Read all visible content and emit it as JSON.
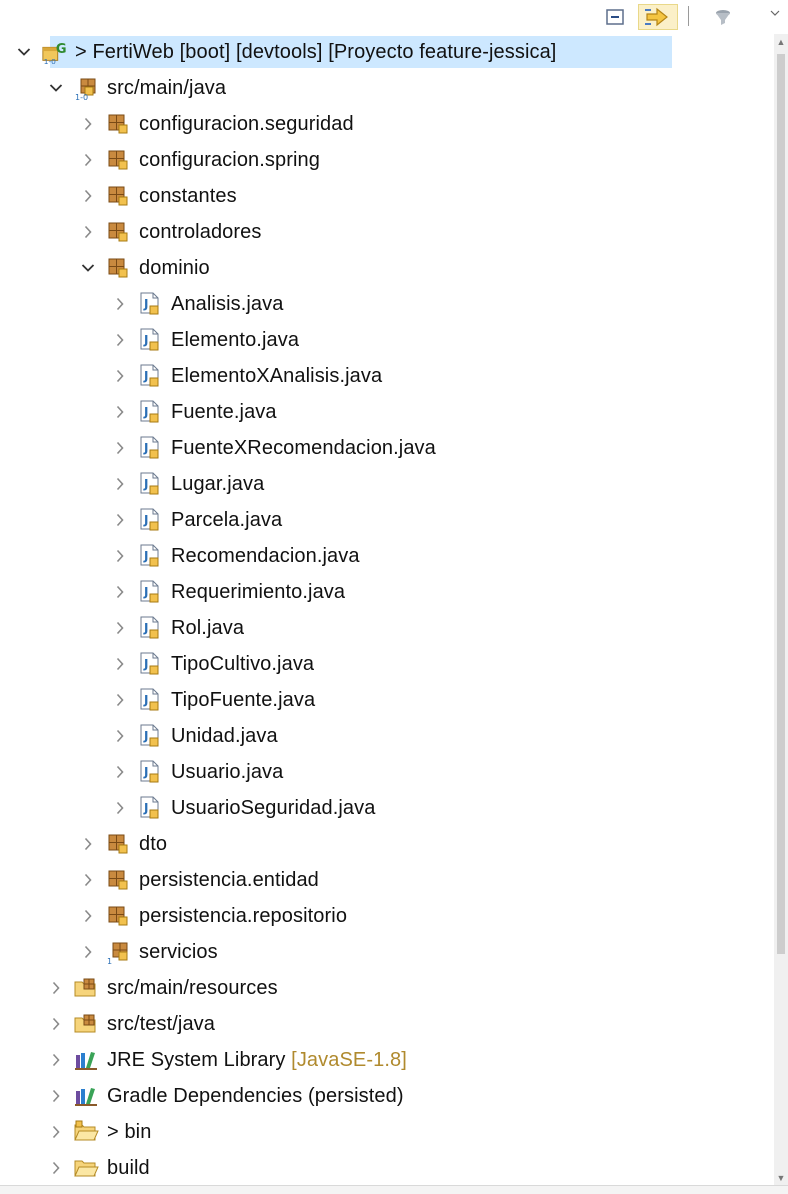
{
  "toolbar": {
    "collapse_icon": "collapse-all-icon",
    "link_icon": "link-with-editor-icon",
    "filter_icon": "filter-icon",
    "menu_icon": "view-menu-icon"
  },
  "colors": {
    "selection": "#cde8ff",
    "text": "#111111",
    "decoration": "#b08a2e",
    "package_brown": "#8a5a2b",
    "java_blue": "#2b6fb6"
  },
  "tree": [
    {
      "level": 0,
      "expanded": true,
      "icon": "gradle-project-icon",
      "prefix": "> ",
      "text": "FertiWeb [boot] [devtools] [Proyecto feature-jessica]",
      "suffix": "",
      "selected": true
    },
    {
      "level": 1,
      "expanded": true,
      "icon": "source-folder-icon",
      "prefix": "",
      "text": "src/main/java",
      "suffix": ""
    },
    {
      "level": 2,
      "expanded": false,
      "icon": "package-icon",
      "prefix": "",
      "text": "configuracion.seguridad",
      "suffix": ""
    },
    {
      "level": 2,
      "expanded": false,
      "icon": "package-icon",
      "prefix": "",
      "text": "configuracion.spring",
      "suffix": ""
    },
    {
      "level": 2,
      "expanded": false,
      "icon": "package-icon",
      "prefix": "",
      "text": "constantes",
      "suffix": ""
    },
    {
      "level": 2,
      "expanded": false,
      "icon": "package-icon",
      "prefix": "",
      "text": "controladores",
      "suffix": ""
    },
    {
      "level": 2,
      "expanded": true,
      "icon": "package-icon",
      "prefix": "",
      "text": "dominio",
      "suffix": ""
    },
    {
      "level": 3,
      "expanded": false,
      "icon": "java-file-icon",
      "prefix": "",
      "text": "Analisis.java",
      "suffix": ""
    },
    {
      "level": 3,
      "expanded": false,
      "icon": "java-file-icon",
      "prefix": "",
      "text": "Elemento.java",
      "suffix": ""
    },
    {
      "level": 3,
      "expanded": false,
      "icon": "java-file-icon",
      "prefix": "",
      "text": "ElementoXAnalisis.java",
      "suffix": ""
    },
    {
      "level": 3,
      "expanded": false,
      "icon": "java-file-icon",
      "prefix": "",
      "text": "Fuente.java",
      "suffix": ""
    },
    {
      "level": 3,
      "expanded": false,
      "icon": "java-file-icon",
      "prefix": "",
      "text": "FuenteXRecomendacion.java",
      "suffix": ""
    },
    {
      "level": 3,
      "expanded": false,
      "icon": "java-file-icon",
      "prefix": "",
      "text": "Lugar.java",
      "suffix": ""
    },
    {
      "level": 3,
      "expanded": false,
      "icon": "java-file-icon",
      "prefix": "",
      "text": "Parcela.java",
      "suffix": ""
    },
    {
      "level": 3,
      "expanded": false,
      "icon": "java-file-icon",
      "prefix": "",
      "text": "Recomendacion.java",
      "suffix": ""
    },
    {
      "level": 3,
      "expanded": false,
      "icon": "java-file-icon",
      "prefix": "",
      "text": "Requerimiento.java",
      "suffix": ""
    },
    {
      "level": 3,
      "expanded": false,
      "icon": "java-file-icon",
      "prefix": "",
      "text": "Rol.java",
      "suffix": ""
    },
    {
      "level": 3,
      "expanded": false,
      "icon": "java-file-icon",
      "prefix": "",
      "text": "TipoCultivo.java",
      "suffix": ""
    },
    {
      "level": 3,
      "expanded": false,
      "icon": "java-file-icon",
      "prefix": "",
      "text": "TipoFuente.java",
      "suffix": ""
    },
    {
      "level": 3,
      "expanded": false,
      "icon": "java-file-icon",
      "prefix": "",
      "text": "Unidad.java",
      "suffix": ""
    },
    {
      "level": 3,
      "expanded": false,
      "icon": "java-file-icon",
      "prefix": "",
      "text": "Usuario.java",
      "suffix": ""
    },
    {
      "level": 3,
      "expanded": false,
      "icon": "java-file-icon",
      "prefix": "",
      "text": "UsuarioSeguridad.java",
      "suffix": ""
    },
    {
      "level": 2,
      "expanded": false,
      "icon": "package-icon",
      "prefix": "",
      "text": "dto",
      "suffix": ""
    },
    {
      "level": 2,
      "expanded": false,
      "icon": "package-icon",
      "prefix": "",
      "text": "persistencia.entidad",
      "suffix": ""
    },
    {
      "level": 2,
      "expanded": false,
      "icon": "package-icon",
      "prefix": "",
      "text": "persistencia.repositorio",
      "suffix": ""
    },
    {
      "level": 2,
      "expanded": false,
      "icon": "package-info-icon",
      "prefix": "",
      "text": "servicios",
      "suffix": ""
    },
    {
      "level": 1,
      "expanded": false,
      "icon": "resource-folder-icon",
      "prefix": "",
      "text": "src/main/resources",
      "suffix": ""
    },
    {
      "level": 1,
      "expanded": false,
      "icon": "resource-folder-icon",
      "prefix": "",
      "text": "src/test/java",
      "suffix": ""
    },
    {
      "level": 1,
      "expanded": false,
      "icon": "library-icon",
      "prefix": "",
      "text": "JRE System Library ",
      "suffix": "[JavaSE-1.8]"
    },
    {
      "level": 1,
      "expanded": false,
      "icon": "library-icon",
      "prefix": "",
      "text": "Gradle Dependencies (persisted)",
      "suffix": ""
    },
    {
      "level": 1,
      "expanded": false,
      "icon": "folder-modified-icon",
      "prefix": "> ",
      "text": "bin",
      "suffix": ""
    },
    {
      "level": 1,
      "expanded": false,
      "icon": "folder-icon",
      "prefix": "",
      "text": "build",
      "suffix": ""
    }
  ]
}
